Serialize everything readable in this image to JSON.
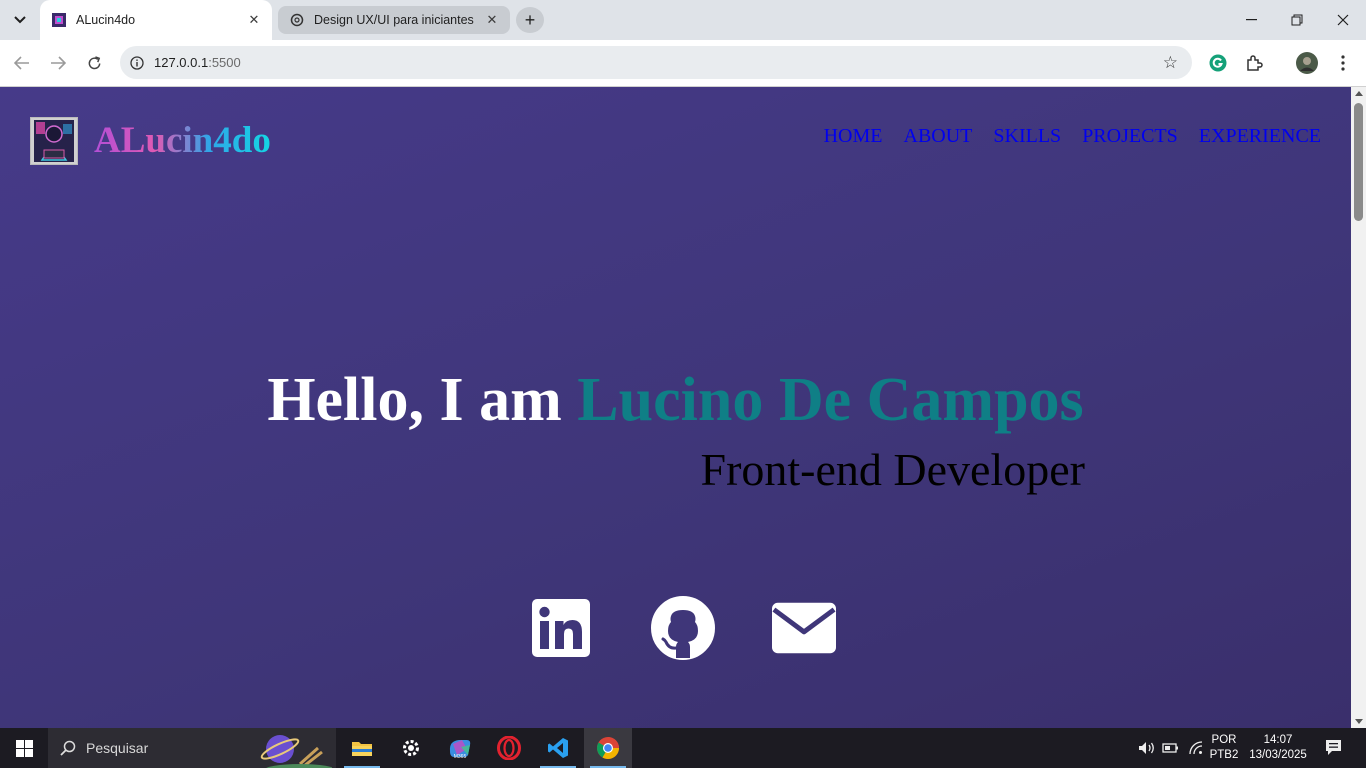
{
  "browser": {
    "tabs": [
      {
        "title": "ALucin4do",
        "active": true
      },
      {
        "title": "Design UX/UI para iniciantes",
        "active": false
      }
    ],
    "url_host": "127.0.0.1",
    "url_port": ":5500"
  },
  "page": {
    "logo_text": "ALucin4do",
    "nav": [
      "HOME",
      "ABOUT",
      "SKILLS",
      "PROJECTS",
      "EXPERIENCE"
    ],
    "hero_greeting": "Hello, I am ",
    "hero_name": "Lucino De Campos",
    "hero_subtitle": "Front-end Developer",
    "social_icons": [
      "linkedin-icon",
      "github-icon",
      "email-icon"
    ],
    "colors": {
      "background": "#423781",
      "name_accent": "#0f7f86",
      "nav_link": "#0000ee"
    }
  },
  "taskbar": {
    "search_placeholder": "Pesquisar",
    "language": "POR",
    "keyboard": "PTB2",
    "time": "14:07",
    "date": "13/03/2025"
  }
}
